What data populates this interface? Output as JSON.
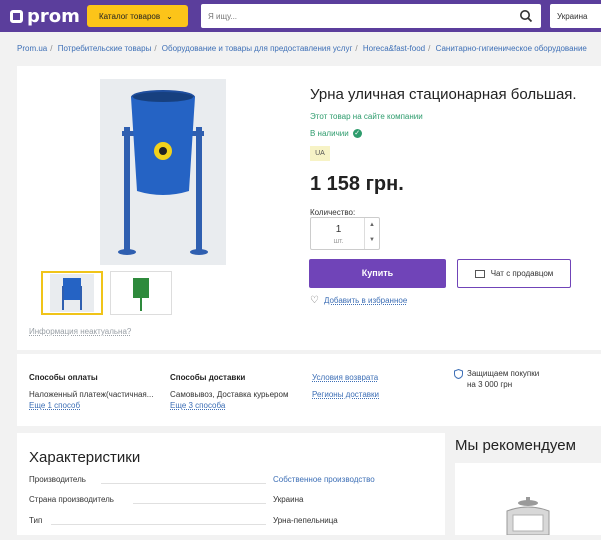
{
  "header": {
    "logo": "prom",
    "catalog_label": "Каталог товаров",
    "search_placeholder": "Я ищу...",
    "region": "Украина"
  },
  "breadcrumbs": [
    "Prom.ua",
    "Потребительские товары",
    "Оборудование и товары для предоставления услуг",
    "Horeca&fast-food",
    "Санитарно-гигиеническое оборудование"
  ],
  "product": {
    "title": "Урна уличная стационарная большая.",
    "seller_link": "Этот товар на сайте компании",
    "stock": "В наличии",
    "badge": "UA",
    "price": "1 158 грн.",
    "qty_label": "Количество:",
    "qty_value": "1",
    "qty_unit": "шт.",
    "buy_label": "Купить",
    "chat_label": "Чат с продавцом",
    "favorite_label": "Добавить в избранное",
    "info_link": "Информация неактуальна?"
  },
  "info_strip": {
    "payment_title": "Способы оплаты",
    "payment_text": "Наложенный платеж(частичная...",
    "payment_more": "Еще 1 способ",
    "delivery_title": "Способы доставки",
    "delivery_text": "Самовывоз, Доставка курьером",
    "delivery_more": "Еще 3 способа",
    "return_link": "Условия возврата",
    "regions_link": "Регионы доставки",
    "protect_line1": "Защищаем покупки",
    "protect_line2": "на 3 000 грн"
  },
  "specs": {
    "title": "Характеристики",
    "rows": [
      {
        "key": "Производитель",
        "value": "Собственное производство"
      },
      {
        "key": "Страна производитель",
        "value": "Украина"
      },
      {
        "key": "Тип",
        "value": "Урна-пепельница"
      }
    ]
  },
  "recommend": {
    "title": "Мы рекомендуем"
  },
  "colors": {
    "header": "#5b3e9c",
    "catalog": "#fcc419",
    "buy": "#7044b8",
    "link": "#3d6fb6",
    "stock": "#2e9c6d"
  }
}
